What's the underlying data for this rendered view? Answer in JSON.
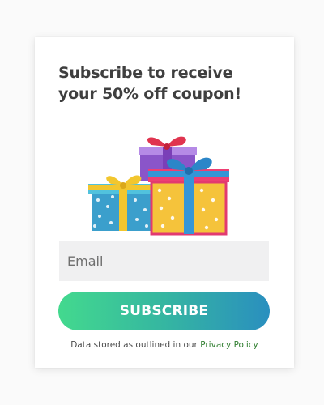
{
  "popup": {
    "title": "Subscribe to receive your 50% off coupon!",
    "gift_illustration": "gift-boxes-icon",
    "email_placeholder": "Email",
    "email_value": "",
    "subscribe_label": "SUBSCRIBE",
    "disclaimer_text": "Data stored as outlined in our ",
    "privacy_link_label": "Privacy Policy"
  },
  "colors": {
    "title_text": "#3f3f3f",
    "button_gradient_start": "#43d98e",
    "button_gradient_end": "#2a8fbf",
    "input_background": "#f0f0f1",
    "link": "#2e7d2e"
  }
}
